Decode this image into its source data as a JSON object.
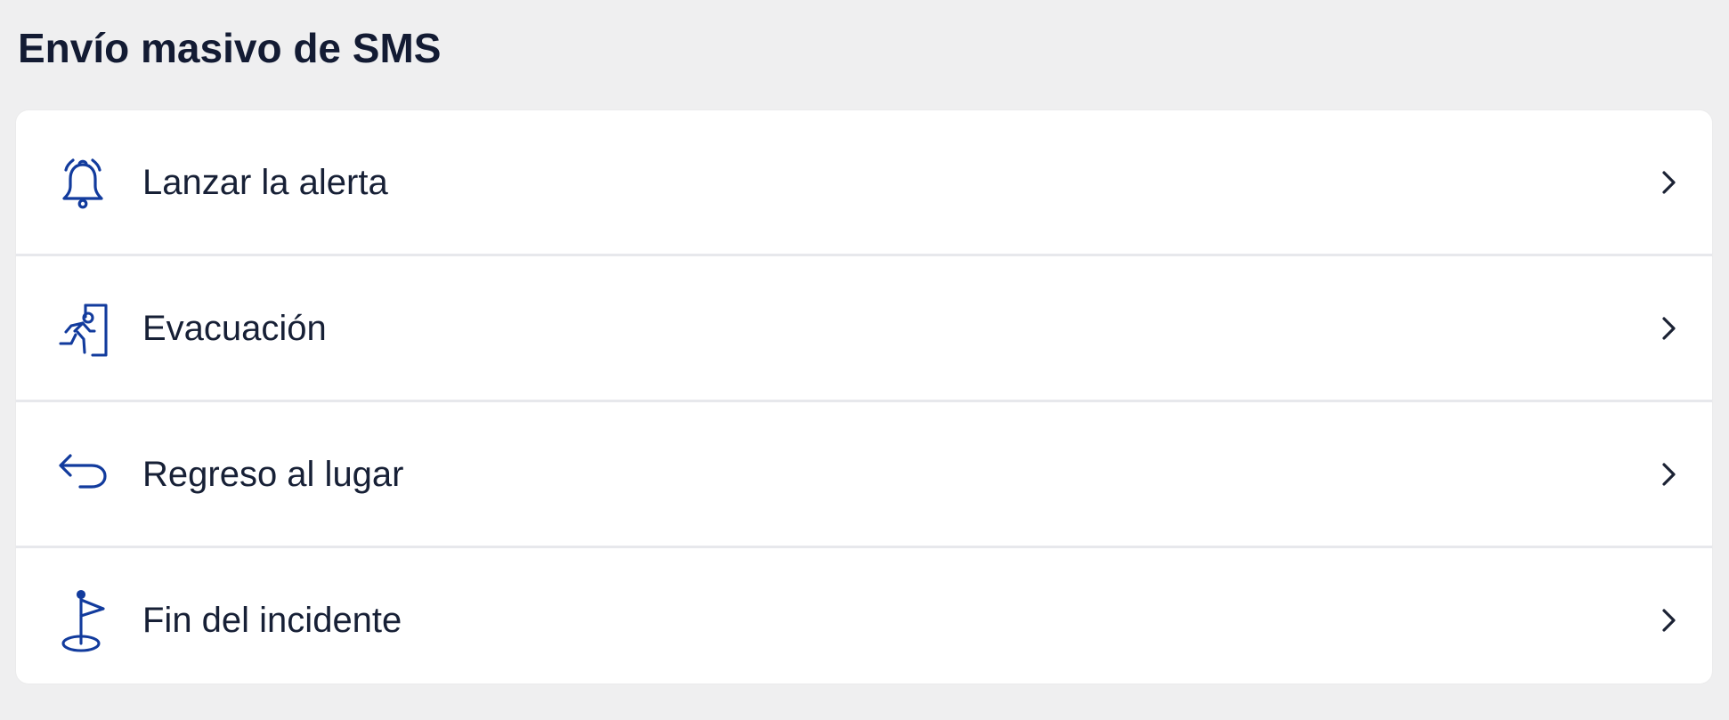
{
  "header": {
    "title": "Envío masivo de SMS"
  },
  "colors": {
    "background": "#efeff0",
    "card": "#ffffff",
    "icon_accent": "#123b9d",
    "text": "#172036",
    "divider": "#e7e8ec"
  },
  "actions": [
    {
      "label": "Lanzar la alerta",
      "icon": "bell-alert-icon",
      "chevron": "chevron-right-icon"
    },
    {
      "label": "Evacuación",
      "icon": "evacuation-exit-icon",
      "chevron": "chevron-right-icon"
    },
    {
      "label": "Regreso al lugar",
      "icon": "return-arrow-icon",
      "chevron": "chevron-right-icon"
    },
    {
      "label": "Fin del incidente",
      "icon": "finish-flag-icon",
      "chevron": "chevron-right-icon"
    }
  ]
}
